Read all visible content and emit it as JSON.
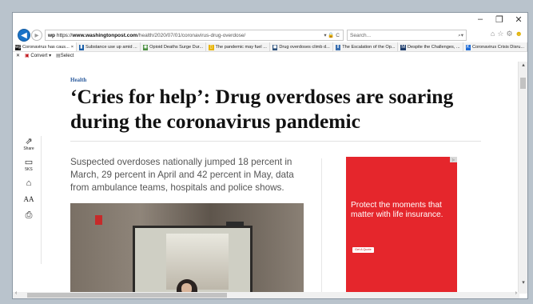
{
  "browser": {
    "url_protocol": "https://",
    "url_site": "www.washingtonpost.com",
    "url_path": "/health/2020/07/01/coronavirus-drug-overdose/",
    "address_icons": "▾ 🔒 C",
    "search_placeholder": "Search...",
    "search_icons": "⌕▾",
    "controls": {
      "minimize": "–",
      "maximize": "❐",
      "close": "✕"
    }
  },
  "tabs": [
    {
      "label": "Coronavirus has caus...",
      "icon": "wp",
      "color": "#111111",
      "active": true
    },
    {
      "label": "Substance use up amid ...",
      "icon": "▮",
      "color": "#1b5fa8"
    },
    {
      "label": "Opioid Deaths Surge Dur...",
      "icon": "◉",
      "color": "#4a8f3f"
    },
    {
      "label": "The pandemic may fuel ...",
      "icon": "▯",
      "color": "#e8b400"
    },
    {
      "label": "Drug overdoses climb d...",
      "icon": "◼",
      "color": "#2a4f7a"
    },
    {
      "label": "The Escalation of the Op...",
      "icon": "Ⅱ",
      "color": "#3a6fb0"
    },
    {
      "label": "Despite the Challenges, ...",
      "icon": "M",
      "color": "#1d3c6b"
    },
    {
      "label": "Coronavirus Crisis Disru...",
      "icon": "K",
      "color": "#1e6bd6"
    }
  ],
  "commandbar": {
    "close_x": "✕",
    "convert_label": "Convert",
    "convert_dd": "▾",
    "select_label": "Select"
  },
  "article": {
    "section": "Health",
    "headline_line1": "‘Cries for help’: Drug overdoses are soaring",
    "headline_line2": "during the coronavirus pandemic",
    "dek": "Suspected overdoses nationally jumped 18 percent in March, 29 percent in April and 42 percent in May, data from ambulance teams, hospitals and police shows."
  },
  "sidebar": {
    "share_label": "Share",
    "comments_count": "5KS",
    "share_icon": "⇗",
    "comment_icon": "▭",
    "home_icon": "⌂",
    "text_size_icon": "AA",
    "print_icon": "⎙"
  },
  "ad": {
    "text": "Protect the moments that matter with life insurance.",
    "button": "Get A Quote",
    "adchoices": "▷"
  },
  "scrollbar": {
    "up": "▴",
    "down": "▾",
    "left": "‹",
    "right": "›"
  }
}
